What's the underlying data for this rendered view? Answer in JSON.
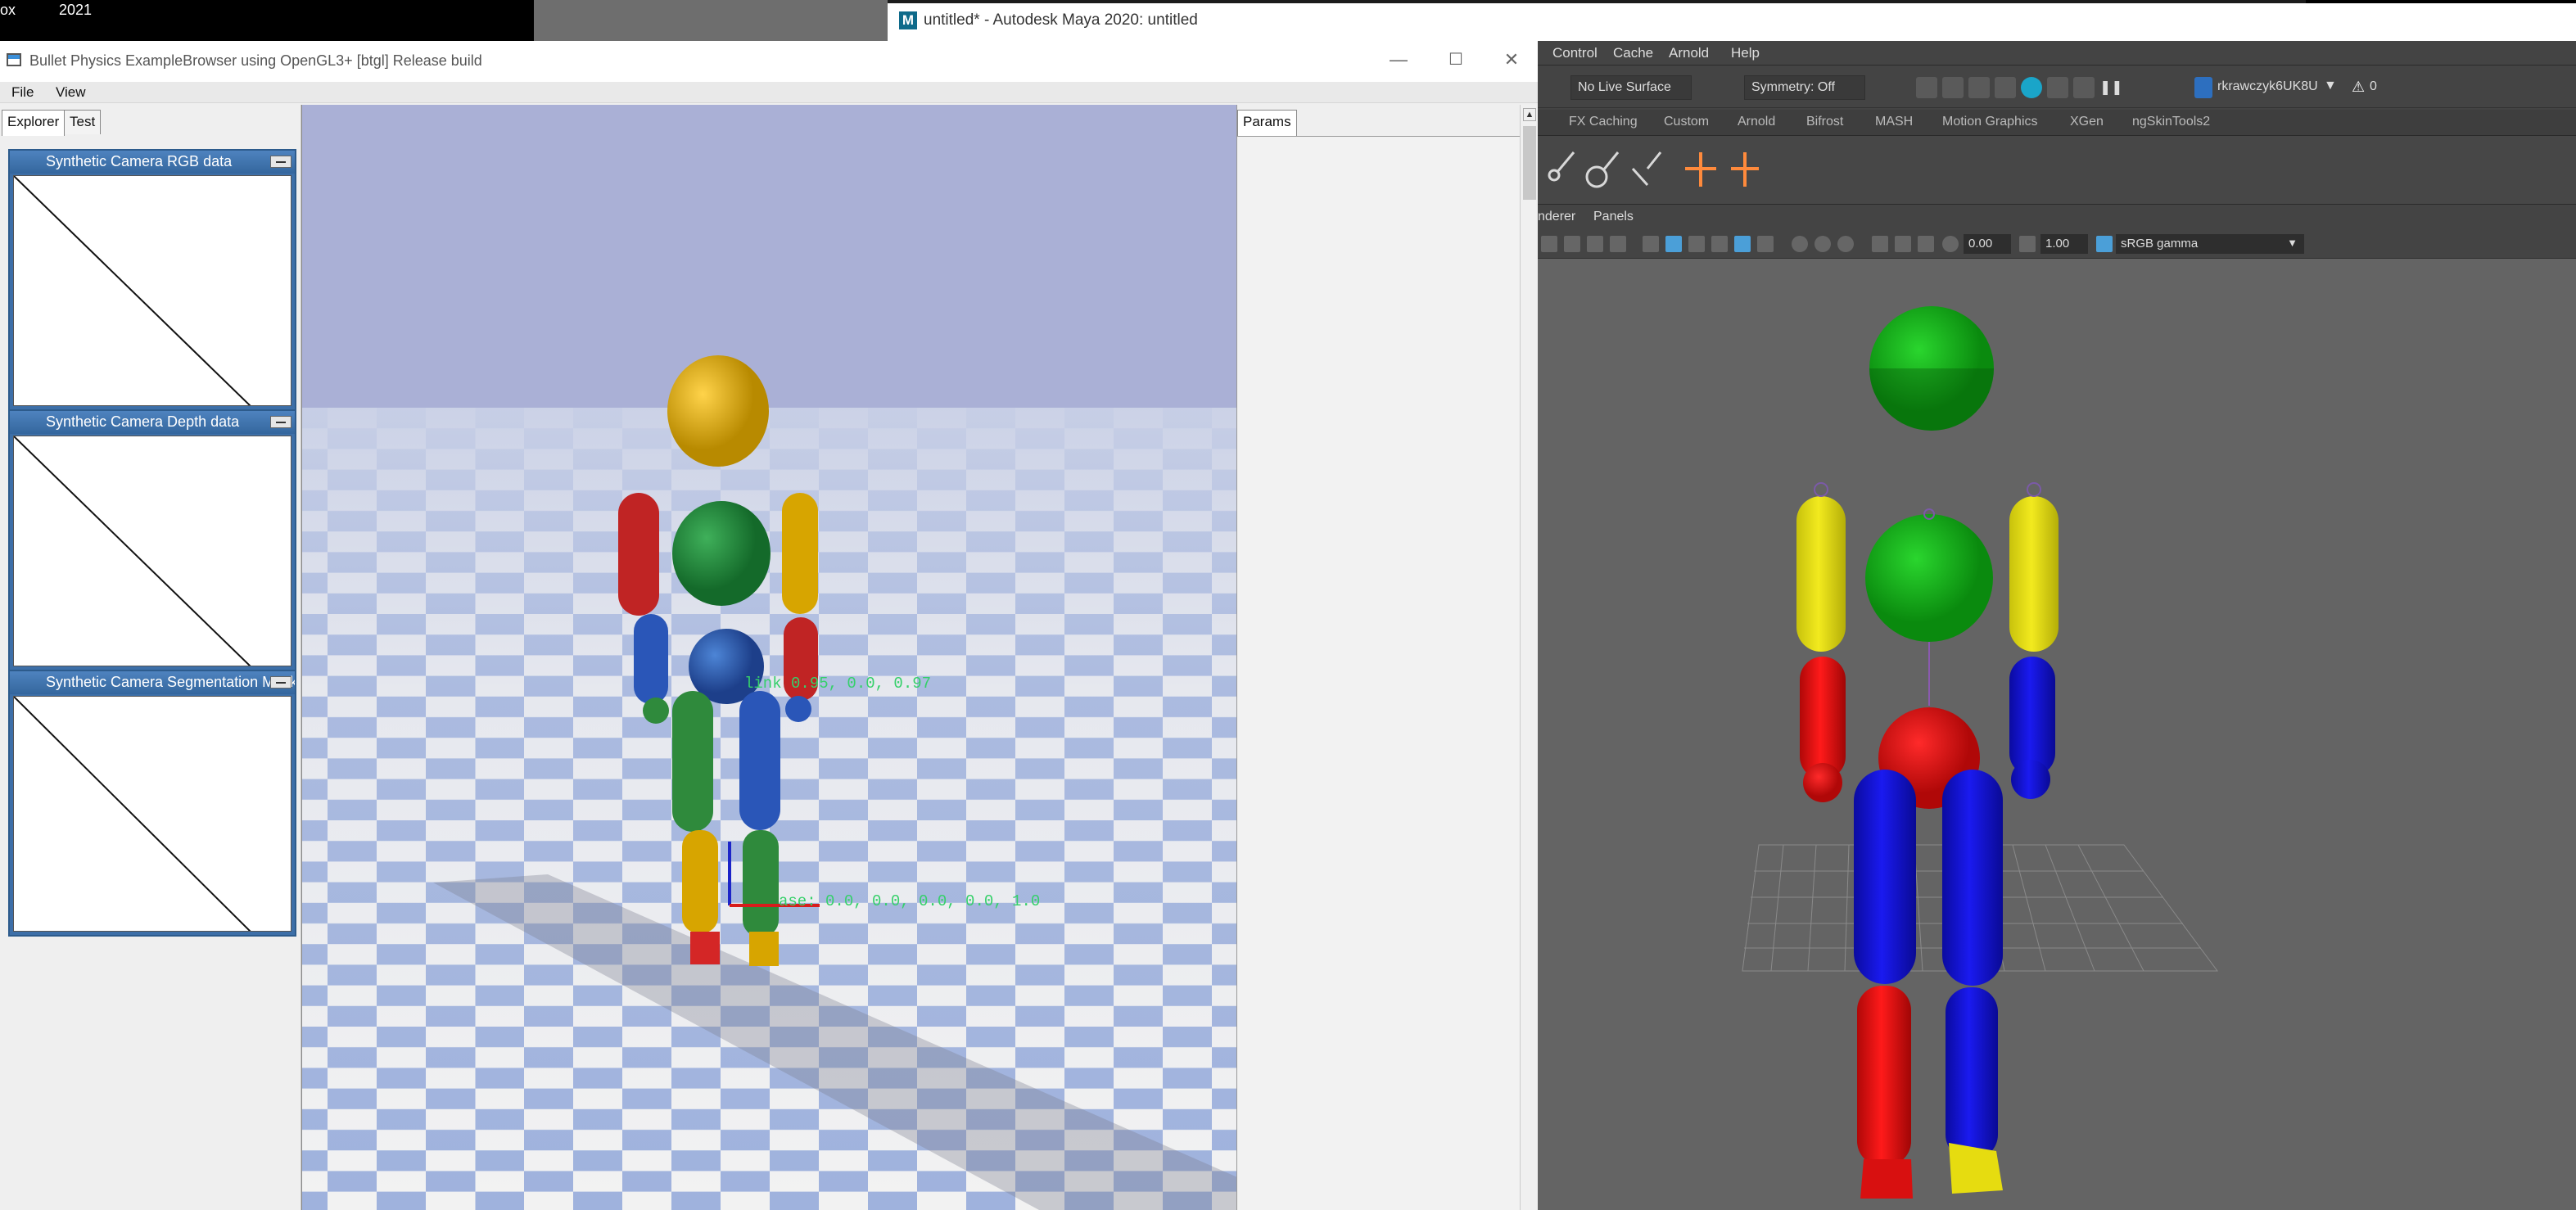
{
  "taskbar": {
    "left_text": "ox",
    "year": "2021"
  },
  "maya_title": {
    "logo": "M",
    "title": "untitled* - Autodesk Maya 2020: untitled"
  },
  "bullet": {
    "title": "Bullet Physics ExampleBrowser using OpenGL3+ [btgl] Release build",
    "window_controls": {
      "minimize": "—",
      "maximize": "☐",
      "close": "✕"
    },
    "menu": [
      "File",
      "View"
    ],
    "tabs": [
      "Explorer",
      "Test"
    ],
    "panels": [
      {
        "title": "Synthetic Camera RGB data"
      },
      {
        "title": "Synthetic Camera Depth data"
      },
      {
        "title": "Synthetic Camera Segmentation Mask"
      }
    ],
    "params_tab": "Params",
    "overlay_texts": [
      "link 0.95, 0.0, 0.97",
      "ase: 0.0, 0.0, 0.0, 0.0, 1.0"
    ]
  },
  "maya": {
    "menu": [
      "Control",
      "Cache",
      "Arnold",
      "Help"
    ],
    "status": {
      "live_surface": "No Live Surface",
      "symmetry": "Symmetry: Off",
      "user": "rkrawczyk6UK8U",
      "warning_count": "0"
    },
    "shelf_tabs": [
      "FX Caching",
      "Custom",
      "Arnold",
      "Bifrost",
      "MASH",
      "Motion Graphics",
      "XGen",
      "ngSkinTools2"
    ],
    "panel_menu": [
      "nderer",
      "Panels"
    ],
    "exposure": "0.00",
    "gamma": "1.00",
    "color_space": "sRGB gamma"
  },
  "colors": {
    "ground_blue": "#aabbe2",
    "sky": "#aab0d6",
    "maya_bg": "#646464",
    "char_green": "#16b61a",
    "char_yellow": "#e3dd12",
    "char_red": "#e01212",
    "char_blue": "#1010e0"
  }
}
